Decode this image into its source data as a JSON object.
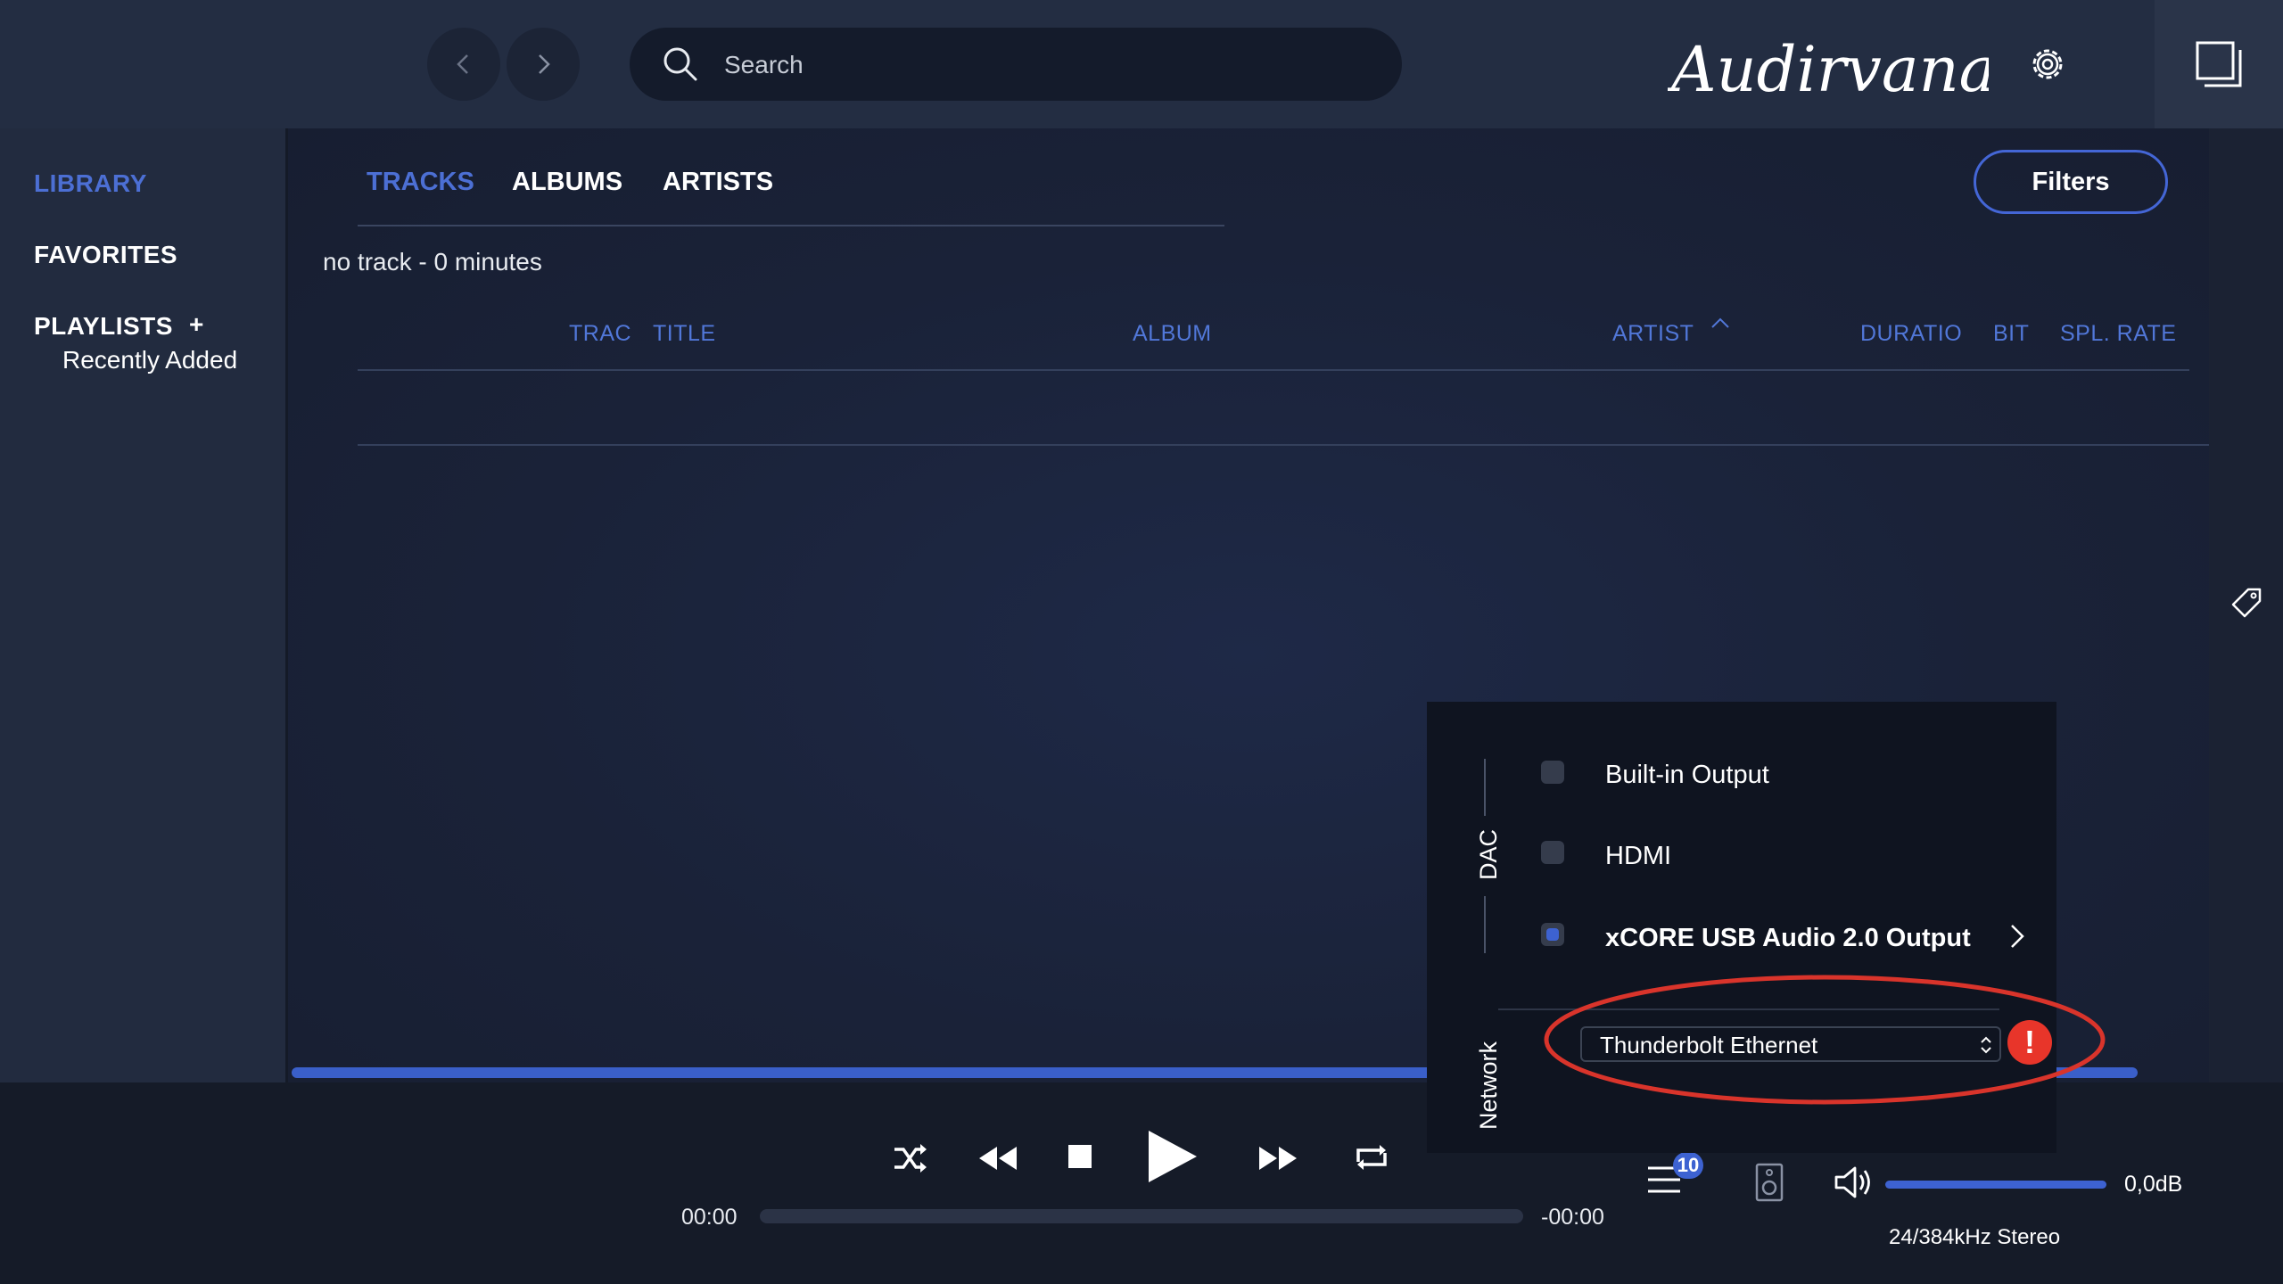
{
  "header": {
    "search_placeholder": "Search",
    "logo_text": "Audirvana",
    "icons": [
      "chevron-left-icon",
      "chevron-right-icon",
      "search-icon",
      "gear-icon",
      "window-toggle-icon"
    ]
  },
  "sidebar": {
    "library": "LIBRARY",
    "favorites": "FAVORITES",
    "playlists": "PLAYLISTS",
    "add_symbol": "+",
    "playlist_items": [
      "Recently Added"
    ]
  },
  "main": {
    "tabs": [
      "TRACKS",
      "ALBUMS",
      "ARTISTS"
    ],
    "active_tab": "TRACKS",
    "filters_label": "Filters",
    "summary": "no track - 0 minutes",
    "columns": [
      "TRAC",
      "TITLE",
      "ALBUM",
      "ARTIST",
      "DURATIO",
      "BIT",
      "SPL. RATE"
    ],
    "sort_indicator": "^"
  },
  "output_popup": {
    "dac_label": "DAC",
    "network_label": "Network",
    "devices": [
      {
        "label": "Built-in Output",
        "selected": false
      },
      {
        "label": "HDMI",
        "selected": false
      },
      {
        "label": "xCORE USB Audio 2.0 Output",
        "selected": true
      }
    ],
    "network_interface": "Thunderbolt Ethernet",
    "warning_symbol": "!"
  },
  "player": {
    "elapsed": "00:00",
    "remaining": "-00:00",
    "queue_count": "10",
    "volume": "0,0dB",
    "format": "24/384kHz Stereo",
    "progress": 0
  },
  "colors": {
    "accent": "#4466d6",
    "highlight_ellipse": "#d9342b",
    "warning": "#e8352a"
  }
}
